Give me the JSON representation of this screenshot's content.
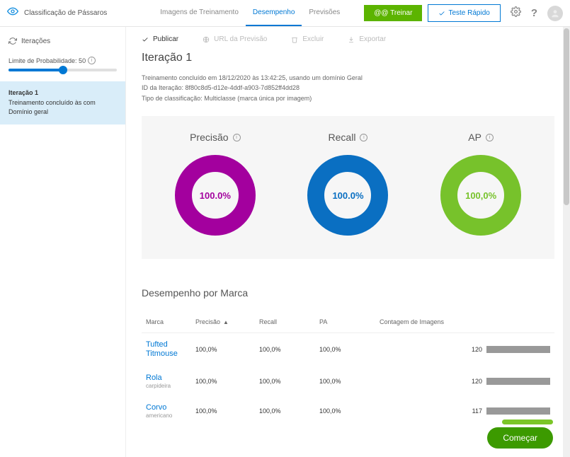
{
  "header": {
    "project_title": "Classificação de Pássaros",
    "tabs": {
      "training": "Imagens de Treinamento",
      "performance": "Desempenho",
      "predictions": "Previsões"
    },
    "train_btn": "@@ Treinar",
    "quick_btn": "Teste Rápido"
  },
  "sidebar": {
    "iterations_label": "Iterações",
    "threshold_label": "Limite de Probabilidade: 50",
    "threshold_value": 50,
    "card": {
      "title": "Iteração 1",
      "line1": "Treinamento concluído às com",
      "line2": "Domínio geral"
    }
  },
  "toolbar": {
    "publish": "Publicar",
    "url": "URL da Previsão",
    "delete": "Excluir",
    "export": "Exportar"
  },
  "iteration": {
    "title": "Iteração 1",
    "finished": "Treinamento concluído em 18/12/2020 às 13:42:25, usando um domínio Geral",
    "id_line": "ID da Iteração: 8f80c8d5-d12e-4ddf-a903-7d852ff4dd28",
    "type_line": "Tipo de classificação: Multiclasse (marca única por imagem)"
  },
  "metrics": {
    "precision": {
      "label": "Precisão",
      "value": "100.0%",
      "color": "#a3009e"
    },
    "recall": {
      "label": "Recall",
      "value": "100.0%",
      "color": "#0a6fc2"
    },
    "ap": {
      "label": "AP",
      "value": "100,0%",
      "color": "#77c22b"
    }
  },
  "perf_title": "Desempenho por Marca",
  "columns": {
    "tag": "Marca",
    "precision": "Precisão",
    "recall": "Recall",
    "ap": "PA",
    "count": "Contagem de Imagens"
  },
  "rows": [
    {
      "tag": "Tufted Titmouse",
      "sub": "",
      "precision": "100,0%",
      "recall": "100,0%",
      "ap": "100,0%",
      "count": "120"
    },
    {
      "tag": "Rola",
      "sub": "carpideira",
      "precision": "100,0%",
      "recall": "100,0%",
      "ap": "100,0%",
      "count": "120"
    },
    {
      "tag": "Corvo",
      "sub": "americano",
      "precision": "100,0%",
      "recall": "100,0%",
      "ap": "100,0%",
      "count": "117"
    }
  ],
  "start_btn": "Começar",
  "chart_data": [
    {
      "type": "pie",
      "title": "Precisão",
      "values": [
        100
      ],
      "categories": [
        "Precisão"
      ],
      "ylim": [
        0,
        100
      ]
    },
    {
      "type": "pie",
      "title": "Recall",
      "values": [
        100
      ],
      "categories": [
        "Recall"
      ],
      "ylim": [
        0,
        100
      ]
    },
    {
      "type": "pie",
      "title": "AP",
      "values": [
        100
      ],
      "categories": [
        "AP"
      ],
      "ylim": [
        0,
        100
      ]
    }
  ]
}
